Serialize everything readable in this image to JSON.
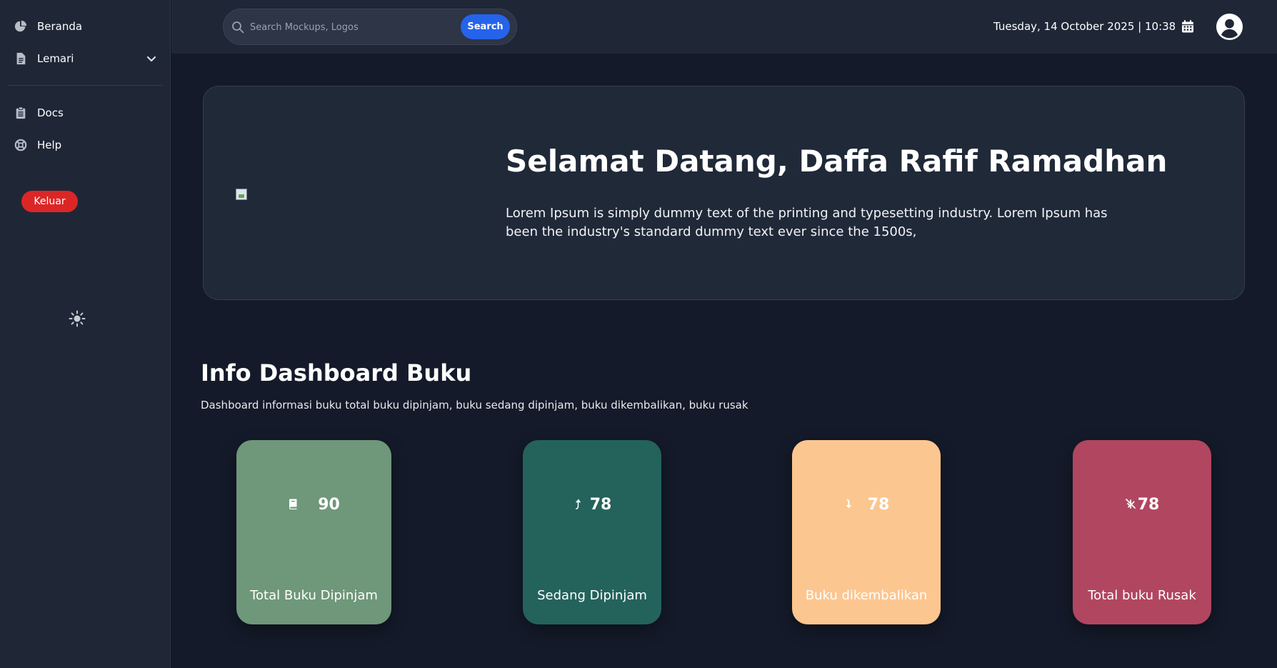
{
  "sidebar": {
    "items": [
      {
        "label": "Beranda",
        "icon": "pie-chart-icon"
      },
      {
        "label": "Lemari",
        "icon": "file-icon",
        "has_dropdown": true
      },
      {
        "label": "Docs",
        "icon": "clipboard-icon"
      },
      {
        "label": "Help",
        "icon": "lifebuoy-icon"
      }
    ],
    "logout_label": "Keluar",
    "theme_icon": "sun-icon"
  },
  "topbar": {
    "search": {
      "placeholder": "Search Mockups, Logos",
      "button_label": "Search"
    },
    "datetime": "Tuesday, 14 October 2025 | 10:38",
    "calendar_icon": "calendar-icon",
    "avatar_icon": "user-circle-icon"
  },
  "hero": {
    "title": "Selamat Datang, Daffa Rafif Ramadhan",
    "description": "Lorem Ipsum is simply dummy text of the printing and typesetting industry. Lorem Ipsum has been the industry's standard dummy text ever since the 1500s,"
  },
  "info": {
    "title": "Info Dashboard Buku",
    "subtitle": "Dashboard informasi buku total buku dipinjam, buku sedang dipinjam, buku dikembalikan, buku rusak",
    "cards": [
      {
        "value": "90",
        "label": "Total Buku Dipinjam",
        "icon": "book-icon",
        "color": "#6f977a"
      },
      {
        "value": "78",
        "label": "Sedang Dipinjam",
        "icon": "arrow-up-icon",
        "color": "#24625c"
      },
      {
        "value": "78",
        "label": "Buku dikembalikan",
        "icon": "arrow-down-icon",
        "color": "#fcc690"
      },
      {
        "value": "78",
        "label": "Total buku Rusak",
        "icon": "broken-icon",
        "color": "#b14660"
      }
    ]
  }
}
